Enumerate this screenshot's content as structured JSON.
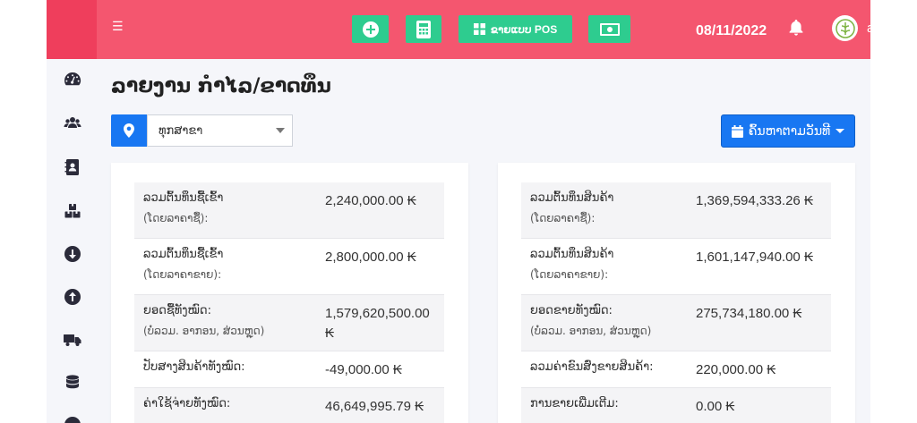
{
  "topbar": {
    "pos_label": "ຂາຍແບບ POS",
    "date": "08/11/2022",
    "username": "admin",
    "colors": {
      "topbar": "#f4566f",
      "accent_button": "#2ecc8f",
      "primary": "#1877f2"
    }
  },
  "sidebar": {
    "icons": [
      "dashboard-icon",
      "users-icon",
      "contacts-icon",
      "boxes-icon",
      "arrow-down-circle-icon",
      "arrow-up-circle-icon",
      "truck-icon",
      "database-icon"
    ]
  },
  "page": {
    "title": "ລາຍງານ ກຳໄລ/ຂາດທຶນ",
    "branch_value": "ທຸກສາຂາ",
    "date_filter_label": "ຄົ້ນຫາຕາມວັນທີ"
  },
  "left_card": {
    "rows": [
      {
        "label": "ລວມຕົ້ນທຶນຊື້ເຂົ້າ",
        "sub": "(ໂດຍລາຄາຊື້):",
        "value": "2,240,000.00 ₭"
      },
      {
        "label": "ລວມຕົ້ນທຶນຊື້ເຂົ້າ",
        "sub": "(ໂດຍລາຄາຂາຍ):",
        "value": "2,800,000.00 ₭"
      },
      {
        "label": "ຍອດຊື້ທັງໝົດ:",
        "sub": "(ບໍ່ລວມ. ອາກອນ, ສ່ວນຫຼຸດ)",
        "value": "1,579,620,500.00 ₭"
      },
      {
        "label": "ປັບສາງສິນຄ້າທັງໝົດ:",
        "sub": "",
        "value": "-49,000.00 ₭"
      },
      {
        "label": "ຄ່າໃຊ້ຈ່າຍທັງໝົດ:",
        "sub": "",
        "value": "46,649,995.79 ₭"
      }
    ]
  },
  "right_card": {
    "rows": [
      {
        "label": "ລວມຕົ້ນທຶນສິນຄ້າ",
        "sub": "(ໂດຍລາຄາຊື້):",
        "value": "1,369,594,333.26 ₭"
      },
      {
        "label": "ລວມຕົ້ນທຶນສິນຄ້າ",
        "sub": "(ໂດຍລາຄາຂາຍ):",
        "value": "1,601,147,940.00 ₭"
      },
      {
        "label": "ຍອດຂາຍທັງໝົດ:",
        "sub": "(ບໍ່ລວມ. ອາກອນ, ສ່ວນຫຼຸດ)",
        "value": "275,734,180.00 ₭"
      },
      {
        "label": "ລວມຄ່າຂົນສົ່ງຂາຍສິນຄ້າ:",
        "sub": "",
        "value": "220,000.00 ₭"
      },
      {
        "label": "ການຂາຍເພີ່ມເຕີມ:",
        "sub": "",
        "value": "0.00 ₭"
      }
    ]
  }
}
